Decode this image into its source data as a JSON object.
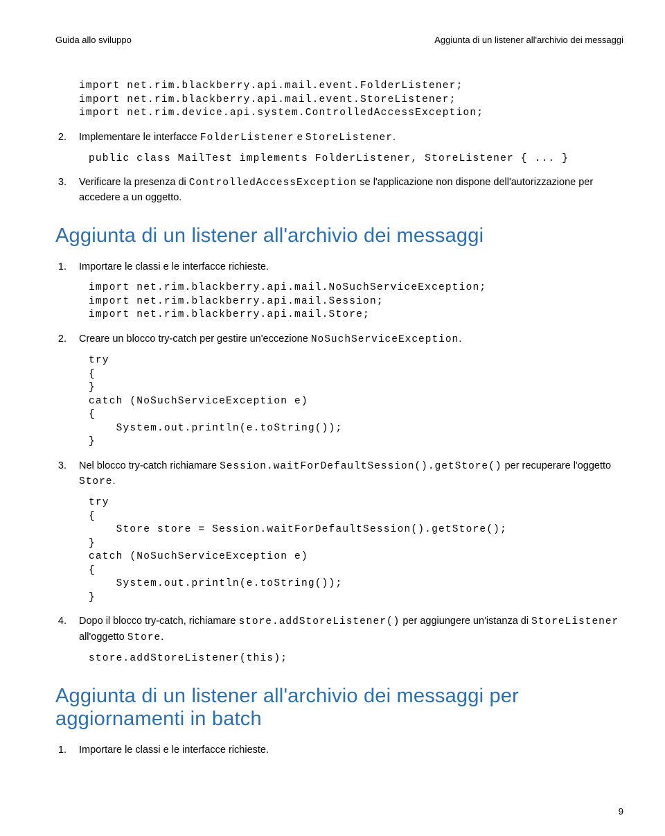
{
  "header": {
    "left": "Guida allo sviluppo",
    "right": "Aggiunta di un listener all'archivio dei messaggi"
  },
  "block1": {
    "code0": "import net.rim.blackberry.api.mail.event.FolderListener;\nimport net.rim.blackberry.api.mail.event.StoreListener;\nimport net.rim.device.api.system.ControlledAccessException;",
    "step2_a": "Implementare le interfacce ",
    "step2_b": "FolderListener",
    "step2_c": " e ",
    "step2_d": "StoreListener",
    "step2_e": ".",
    "code2": "public class MailTest implements FolderListener, StoreListener { ... }",
    "step3_a": "Verificare la presenza di ",
    "step3_b": "ControlledAccessException",
    "step3_c": " se l'applicazione non dispone dell'autorizzazione per accedere a un oggetto."
  },
  "heading1": "Aggiunta di un listener all'archivio dei messaggi",
  "block2": {
    "step1": "Importare le classi e le interfacce richieste.",
    "code1": "import net.rim.blackberry.api.mail.NoSuchServiceException;\nimport net.rim.blackberry.api.mail.Session;\nimport net.rim.blackberry.api.mail.Store;",
    "step2_a": "Creare un blocco try-catch per gestire un'eccezione ",
    "step2_b": "NoSuchServiceException",
    "step2_c": ".",
    "code2": "try\n{\n}\ncatch (NoSuchServiceException e)\n{\n    System.out.println(e.toString());\n}",
    "step3_a": "Nel blocco try-catch richiamare ",
    "step3_b": "Session.waitForDefaultSession().getStore()",
    "step3_c": " per recuperare l'oggetto ",
    "step3_d": "Store",
    "step3_e": ".",
    "code3": "try\n{\n    Store store = Session.waitForDefaultSession().getStore();\n}\ncatch (NoSuchServiceException e)\n{\n    System.out.println(e.toString());\n}",
    "step4_a": "Dopo il blocco try-catch, richiamare ",
    "step4_b": "store.addStoreListener()",
    "step4_c": " per aggiungere un'istanza di ",
    "step4_d": "StoreListener",
    "step4_e": " all'oggetto ",
    "step4_f": "Store",
    "step4_g": ".",
    "code4": "store.addStoreListener(this);"
  },
  "heading2": "Aggiunta di un listener all'archivio dei messaggi per aggiornamenti in batch",
  "block3": {
    "step1": "Importare le classi e le interfacce richieste."
  },
  "page_number": "9"
}
